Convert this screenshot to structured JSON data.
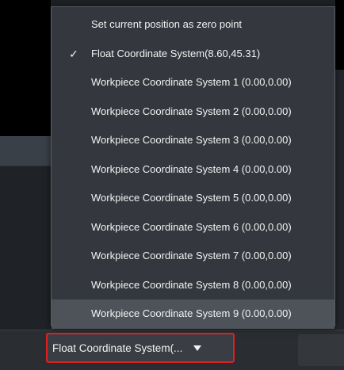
{
  "menu": {
    "items": [
      {
        "label": "Set current position as zero point",
        "checked": false
      },
      {
        "label": "Float Coordinate System(8.60,45.31)",
        "checked": true
      },
      {
        "label": "Workpiece Coordinate System 1 (0.00,0.00)",
        "checked": false
      },
      {
        "label": "Workpiece Coordinate System 2 (0.00,0.00)",
        "checked": false
      },
      {
        "label": "Workpiece Coordinate System 3 (0.00,0.00)",
        "checked": false
      },
      {
        "label": "Workpiece Coordinate System 4 (0.00,0.00)",
        "checked": false
      },
      {
        "label": "Workpiece Coordinate System 5 (0.00,0.00)",
        "checked": false
      },
      {
        "label": "Workpiece Coordinate System 6 (0.00,0.00)",
        "checked": false
      },
      {
        "label": "Workpiece Coordinate System 7 (0.00,0.00)",
        "checked": false
      },
      {
        "label": "Workpiece Coordinate System 8 (0.00,0.00)",
        "checked": false
      },
      {
        "label": "Workpiece Coordinate System 9 (0.00,0.00)",
        "checked": false,
        "highlighted": true
      }
    ],
    "check_glyph": "✓"
  },
  "selector": {
    "value": "Float Coordinate System(...",
    "highlight_color": "#e02020"
  },
  "colors": {
    "menu_bg": "#34383e",
    "menu_hover": "#4e535a",
    "text": "#f2f2f2"
  }
}
